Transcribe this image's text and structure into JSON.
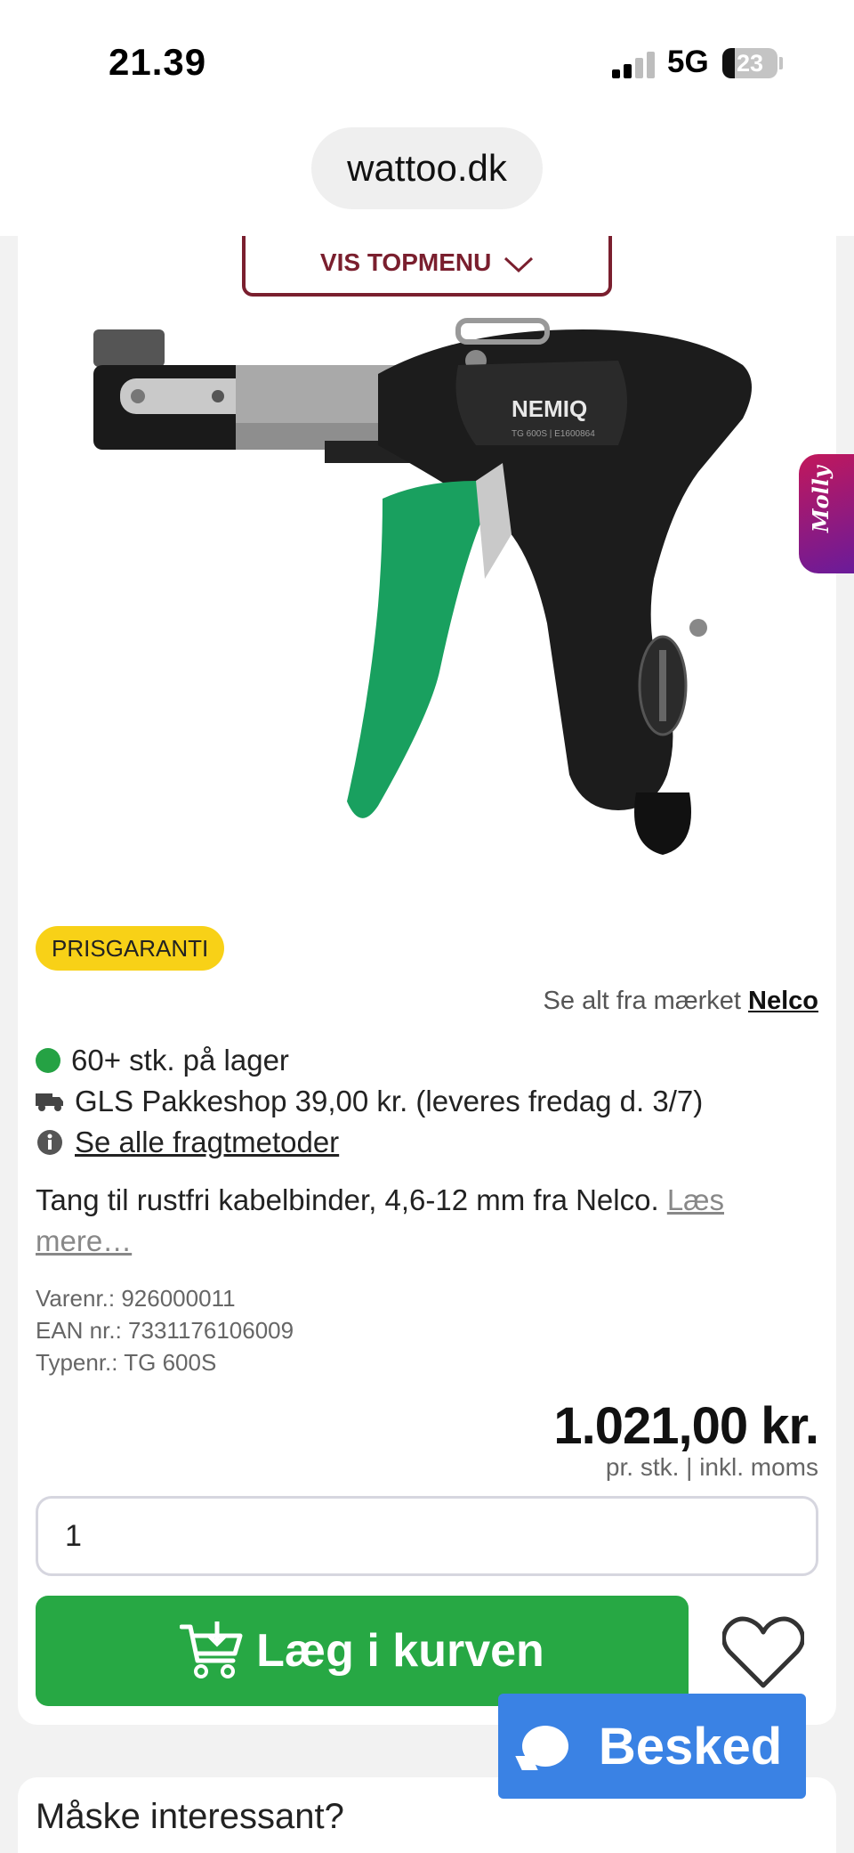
{
  "status_bar": {
    "time": "21.39",
    "network": "5G",
    "battery": "23"
  },
  "browser": {
    "url": "wattoo.dk"
  },
  "menu": {
    "button_label": "VIS TOPMENU"
  },
  "product": {
    "badge": "PRISGARANTI",
    "brand_prefix": "Se alt fra mærket",
    "brand": "Nelco",
    "stock": "60+ stk. på lager",
    "shipping": "GLS Pakkeshop 39,00 kr. (leveres fredag d. 3/7)",
    "shipping_link": "Se alle fragtmetoder",
    "description": "Tang til rustfri kabelbinder, 4,6-12 mm fra Nelco.",
    "read_more": "Læs mere…",
    "varenr": "Varenr.: 926000011",
    "ean": "EAN nr.: 7331176106009",
    "typenr": "Typenr.: TG 600S",
    "price": "1.021,00 kr.",
    "price_note": "pr. stk. | inkl. moms",
    "quantity": "1",
    "add_to_cart": "Læg i kurven",
    "image_brand": "NEMIQ",
    "image_model": "TG 600S | E1600864"
  },
  "chat": {
    "label": "Besked"
  },
  "side_widget": {
    "label": "Molly"
  },
  "section2": {
    "title": "Måske interessant?"
  },
  "colors": {
    "accent": "#27a844",
    "menu": "#7a1f2e",
    "badge": "#f8d117",
    "chat": "#3a82e4"
  }
}
